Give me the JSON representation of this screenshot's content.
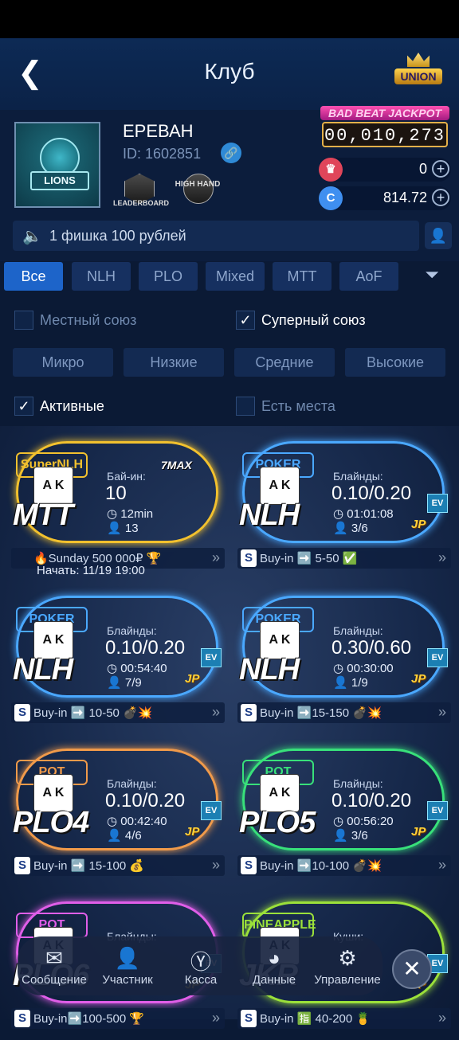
{
  "header": {
    "title": "Клуб",
    "union_label": "UNION"
  },
  "club": {
    "name": "ЕРЕВАН",
    "id": "ID: 1602851",
    "logo_text": "LIONS",
    "badges": [
      {
        "label": "LEADERBOARD"
      },
      {
        "label": "HIGH HAND"
      }
    ],
    "jackpot_title": "BAD BEAT JACKPOT",
    "jackpot_value": "00,010,273",
    "balance_diamond": "0",
    "balance_coin": "814.72"
  },
  "notice": {
    "text": "1 фишка 100 рублей"
  },
  "tabs": [
    {
      "label": "Все",
      "active": true
    },
    {
      "label": "NLH"
    },
    {
      "label": "PLO"
    },
    {
      "label": "Mixed"
    },
    {
      "label": "MTT"
    },
    {
      "label": "AoF"
    }
  ],
  "filters": {
    "local_union": {
      "label": "Местный союз",
      "checked": false
    },
    "super_union": {
      "label": "Суперный союз",
      "checked": true
    },
    "levels": [
      "Микро",
      "Низкие",
      "Средние",
      "Высокие"
    ],
    "active": {
      "label": "Активные",
      "checked": true
    },
    "seats": {
      "label": "Есть места",
      "checked": false
    }
  },
  "cards": [
    {
      "game": "MTT",
      "sign": "SuperNLH",
      "label": "Бай-ин:",
      "value": "10",
      "time": "12min",
      "players": "13",
      "max": "7MAX",
      "footer": "🔥Sunday 500 000₽ 🏆",
      "extra": "Начать: 11/19 19:00",
      "color": "#f2c12e"
    },
    {
      "game": "NLH",
      "sign": "POKER",
      "label": "Блайнды:",
      "value": "0.10/0.20",
      "time": "01:01:08",
      "players": "3/6",
      "footer": "Buy-in ➡️ 5-50 ✅",
      "color": "#4aa8ff"
    },
    {
      "game": "NLH",
      "sign": "POKER",
      "label": "Блайнды:",
      "value": "0.10/0.20",
      "time": "00:54:40",
      "players": "7/9",
      "footer": "Buy-in ➡️ 10-50 💣💥",
      "color": "#4aa8ff"
    },
    {
      "game": "NLH",
      "sign": "POKER",
      "label": "Блайнды:",
      "value": "0.30/0.60",
      "time": "00:30:00",
      "players": "1/9",
      "footer": "Buy-in ➡️15-150 💣💥",
      "color": "#4aa8ff"
    },
    {
      "game": "PLO4",
      "sign": "POT",
      "label": "Блайнды:",
      "value": "0.10/0.20",
      "time": "00:42:40",
      "players": "4/6",
      "footer": "Buy-in ➡️ 15-100 💰",
      "color": "#f09a4a"
    },
    {
      "game": "PLO5",
      "sign": "POT",
      "label": "Блайнды:",
      "value": "0.10/0.20",
      "time": "00:56:20",
      "players": "3/6",
      "footer": "Buy-in ➡️10-100 💣💥",
      "color": "#38e07a"
    },
    {
      "game": "PLO6",
      "sign": "POT",
      "label": "Блайнды:",
      "value": "",
      "time": "",
      "players": "",
      "footer": "Buy-in➡️100-500 🏆",
      "color": "#e05ee8"
    },
    {
      "game": "JKR",
      "sign": "PINEAPPLE",
      "label": "Куши:",
      "value": "",
      "time": "",
      "players": "",
      "footer": "Buy-in 🈯 40-200 🍍",
      "color": "#9be03a"
    }
  ],
  "nav": [
    {
      "label": "Сообщение"
    },
    {
      "label": "Участник"
    },
    {
      "label": "Касса"
    },
    {
      "label": "Данные"
    },
    {
      "label": "Управление"
    }
  ],
  "colors": {
    "accent": "#1d64c9",
    "background": "#0b1a35"
  }
}
